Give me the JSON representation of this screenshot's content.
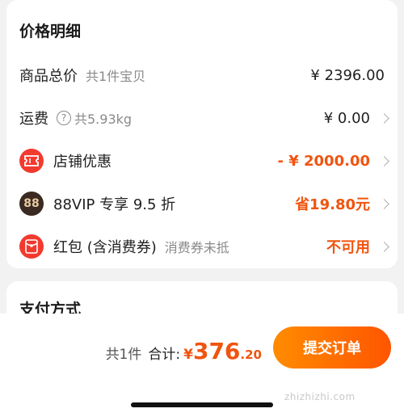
{
  "price_card": {
    "title": "价格明细",
    "goods": {
      "label": "商品总价",
      "sub": "共1件宝贝",
      "value": "¥ 2396.00"
    },
    "shipping": {
      "label": "运费",
      "help": "?",
      "sub": "共5.93kg",
      "value": "¥ 0.00"
    },
    "shop_discount": {
      "label": "店铺优惠",
      "value": "- ¥ 2000.00",
      "icon": "ticket-icon"
    },
    "vip": {
      "icon_text": "88",
      "label": "88VIP 专享 9.5 折",
      "value": "省19.80元"
    },
    "red_packet": {
      "label": "红包 (含消费券)",
      "sub": "消费券未抵",
      "value": "不可用",
      "icon": "red-envelope-icon"
    }
  },
  "payment": {
    "title": "支付方式"
  },
  "bottom": {
    "count": "共1件",
    "total_label": "合计:",
    "currency": "¥",
    "total_int": "376",
    "total_dec": ".20",
    "submit": "提交订单",
    "watermark": "zhizhizhi.com"
  },
  "colors": {
    "accent": "#f0540f",
    "button_start": "#ff8c00",
    "button_end": "#ff5500",
    "coupon_red": "#f23a2f"
  }
}
